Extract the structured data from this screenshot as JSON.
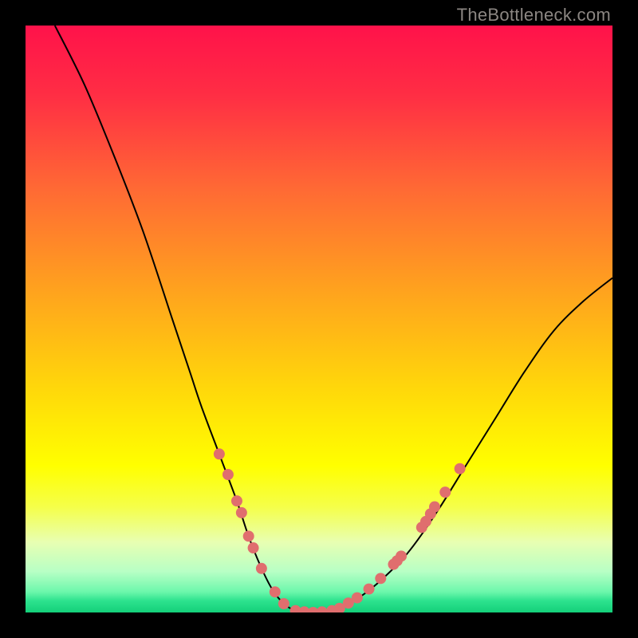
{
  "watermark": {
    "text": "TheBottleneck.com"
  },
  "colors": {
    "frame": "#000000",
    "curve": "#000000",
    "dot": "#e06e6e",
    "watermark": "#8b8682",
    "gradient_stops": [
      {
        "offset": 0.0,
        "color": "#ff124a"
      },
      {
        "offset": 0.12,
        "color": "#ff2e44"
      },
      {
        "offset": 0.28,
        "color": "#ff6a34"
      },
      {
        "offset": 0.45,
        "color": "#ffa21e"
      },
      {
        "offset": 0.62,
        "color": "#ffd80a"
      },
      {
        "offset": 0.75,
        "color": "#ffff00"
      },
      {
        "offset": 0.82,
        "color": "#f5ff49"
      },
      {
        "offset": 0.88,
        "color": "#e8ffb2"
      },
      {
        "offset": 0.93,
        "color": "#b8ffc5"
      },
      {
        "offset": 0.965,
        "color": "#6cf7ab"
      },
      {
        "offset": 0.98,
        "color": "#2de28e"
      },
      {
        "offset": 1.0,
        "color": "#14d07a"
      }
    ]
  },
  "chart_data": {
    "type": "line",
    "title": "",
    "xlabel": "",
    "ylabel": "",
    "xlim": [
      0,
      100
    ],
    "ylim": [
      0,
      100
    ],
    "grid": false,
    "legend": false,
    "series": [
      {
        "name": "bottleneck-curve",
        "x": [
          5,
          10,
          15,
          20,
          25,
          28,
          30,
          33,
          36,
          38,
          40,
          42,
          44,
          46,
          48,
          50,
          53,
          56,
          60,
          65,
          70,
          75,
          80,
          85,
          90,
          95,
          100
        ],
        "y": [
          100,
          90,
          78,
          65,
          50,
          41,
          35,
          27,
          19,
          13,
          8,
          4,
          1.5,
          0.3,
          0,
          0,
          0.5,
          2,
          5,
          10,
          17,
          25,
          33,
          41,
          48,
          53,
          57
        ]
      }
    ],
    "annotations": {
      "dots_xy": [
        [
          33,
          27
        ],
        [
          34.5,
          23.5
        ],
        [
          36,
          19
        ],
        [
          36.8,
          17
        ],
        [
          38,
          13
        ],
        [
          38.8,
          11
        ],
        [
          40.2,
          7.5
        ],
        [
          42.5,
          3.5
        ],
        [
          44,
          1.5
        ],
        [
          46,
          0.3
        ],
        [
          47.5,
          0.1
        ],
        [
          49,
          0
        ],
        [
          50.5,
          0.1
        ],
        [
          52.2,
          0.3
        ],
        [
          53.5,
          0.7
        ],
        [
          55,
          1.6
        ],
        [
          56.5,
          2.5
        ],
        [
          58.5,
          4
        ],
        [
          60.5,
          5.8
        ],
        [
          62.7,
          8.2
        ],
        [
          63.3,
          8.8
        ],
        [
          64,
          9.6
        ],
        [
          67.5,
          14.5
        ],
        [
          68.2,
          15.5
        ],
        [
          69,
          16.8
        ],
        [
          69.7,
          18
        ],
        [
          71.5,
          20.5
        ],
        [
          74,
          24.5
        ]
      ]
    }
  }
}
